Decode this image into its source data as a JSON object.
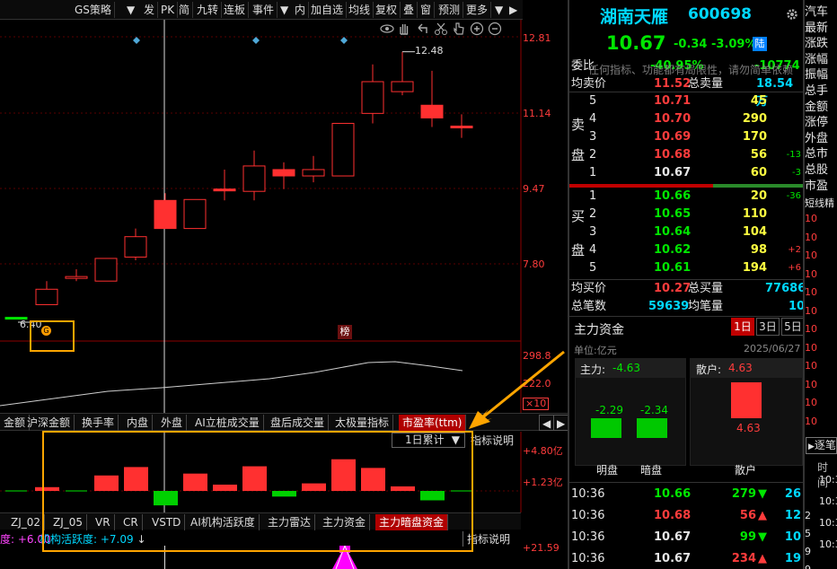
{
  "toolbar": {
    "items": [
      "GS策略",
      "▼",
      "发",
      "PK",
      "简",
      "九转",
      "连板",
      "事件",
      "▼",
      "内",
      "加自选",
      "均线",
      "复权",
      "叠",
      "窗",
      "预测",
      "更多",
      "▼",
      "▶"
    ]
  },
  "chart_icons": [
    "eye-icon",
    "hand-icon",
    "undo-icon",
    "scissors-icon",
    "zoom-in-icon",
    "zoom-out-icon"
  ],
  "price_axis": [
    "12.81",
    "11.14",
    "9.47",
    "7.80"
  ],
  "candles": {
    "high_label": "12.48",
    "low_label": "6.40",
    "bang_label": "榜",
    "g_label": "G",
    "items": [
      {
        "o": 6.62,
        "c": 6.62,
        "h": 6.62,
        "l": 6.62,
        "color": "green"
      },
      {
        "o": 6.9,
        "c": 7.24,
        "h": 7.42,
        "l": 6.9,
        "color": "red"
      },
      {
        "o": 7.52,
        "c": 7.48,
        "h": 7.68,
        "l": 7.42,
        "color": "red"
      },
      {
        "o": 7.42,
        "c": 7.92,
        "h": 7.92,
        "l": 7.42,
        "color": "red"
      },
      {
        "o": 7.95,
        "c": 8.4,
        "h": 8.58,
        "l": 7.88,
        "color": "red"
      },
      {
        "o": 8.58,
        "c": 9.2,
        "h": 9.36,
        "l": 8.58,
        "color": "red-filled"
      },
      {
        "o": 8.58,
        "c": 9.22,
        "h": 9.22,
        "l": 8.58,
        "color": "red"
      },
      {
        "o": 9.45,
        "c": 9.45,
        "h": 9.88,
        "l": 9.2,
        "color": "red"
      },
      {
        "o": 9.4,
        "c": 9.96,
        "h": 10.3,
        "l": 9.2,
        "color": "red"
      },
      {
        "o": 9.88,
        "c": 9.74,
        "h": 10.04,
        "l": 9.45,
        "color": "red-filled"
      },
      {
        "o": 9.88,
        "c": 9.74,
        "h": 10.18,
        "l": 9.6,
        "color": "red"
      },
      {
        "o": 9.74,
        "c": 10.9,
        "h": 10.9,
        "l": 9.74,
        "color": "red"
      },
      {
        "o": 11.12,
        "c": 11.82,
        "h": 12.2,
        "l": 10.9,
        "color": "red"
      },
      {
        "o": 11.6,
        "c": 11.82,
        "h": 12.48,
        "l": 11.52,
        "color": "red"
      },
      {
        "o": 11.3,
        "c": 11.02,
        "h": 12.06,
        "l": 10.82,
        "color": "red-filled"
      },
      {
        "o": 10.84,
        "c": 10.84,
        "h": 11.1,
        "l": 10.58,
        "color": "red"
      }
    ]
  },
  "vol_axis": {
    "top": "298.8",
    "mid": "222.0",
    "mult": "×10"
  },
  "tabs": [
    "金额",
    "沪深金额",
    "换手率",
    "内盘",
    "外盘",
    "AI立桩成交量",
    "盘后成交量",
    "太极量指标",
    "市盈率(ttm)"
  ],
  "indicator": {
    "select_label": "1日累计",
    "explain_label": "指标说明",
    "axis_top": "+4.80亿",
    "axis_mid": "+1.23亿",
    "bars": [
      0.0,
      0.3,
      0.0,
      1.23,
      1.9,
      -1.15,
      1.38,
      0.5,
      1.96,
      -0.45,
      0.6,
      2.52,
      1.83,
      0.36,
      -0.75,
      0.0
    ]
  },
  "bottom_tabs": [
    "ZJ_02",
    "ZJ_05",
    "VR",
    "CR",
    "VSTD",
    "AI机构活跃度",
    "主力雷达",
    "主力资金",
    "主力暗盘资金"
  ],
  "bottom_status": {
    "left": "度: +6.00",
    "mid_label": "机构活跃度: +7.09",
    "explain": "指标说明",
    "axis": "+21.59"
  },
  "overlay_text": "任何指标、功能都有局限性，请勿简单依赖",
  "quote": {
    "name": "湖南天雁",
    "code": "600698",
    "price": "10.67",
    "change": "-0.34",
    "pct": "-3.09%",
    "badge": "陆",
    "wei_bi_label": "委比",
    "wei_bi": "-40.95%",
    "wei_cha": "-10774",
    "jun_mai_label": "均卖价",
    "jun_mai": "11.52",
    "zong_mai_label": "总卖量",
    "zong_mai": "18.54万",
    "sell_label_1": "卖",
    "sell_label_2": "盘",
    "buy_label_1": "买",
    "buy_label_2": "盘",
    "asks": [
      {
        "lvl": "5",
        "price": "10.71",
        "vol": "45",
        "chg": ""
      },
      {
        "lvl": "4",
        "price": "10.70",
        "vol": "290",
        "chg": ""
      },
      {
        "lvl": "3",
        "price": "10.69",
        "vol": "170",
        "chg": ""
      },
      {
        "lvl": "2",
        "price": "10.68",
        "vol": "56",
        "chg": "-13"
      },
      {
        "lvl": "1",
        "price": "10.67",
        "vol": "60",
        "chg": "-3"
      }
    ],
    "bids": [
      {
        "lvl": "1",
        "price": "10.66",
        "vol": "20",
        "chg": "-36"
      },
      {
        "lvl": "2",
        "price": "10.65",
        "vol": "110",
        "chg": ""
      },
      {
        "lvl": "3",
        "price": "10.64",
        "vol": "104",
        "chg": ""
      },
      {
        "lvl": "4",
        "price": "10.62",
        "vol": "98",
        "chg": "+2"
      },
      {
        "lvl": "5",
        "price": "10.61",
        "vol": "194",
        "chg": "+6"
      }
    ],
    "jun_buy_label": "均买价",
    "jun_buy": "10.27",
    "zong_buy_label": "总买量",
    "zong_buy": "77686",
    "zong_bi_label": "总笔数",
    "zong_bi": "59639",
    "jun_bi_label": "均笔量",
    "jun_bi": "10"
  },
  "fund": {
    "title": "主力资金",
    "tabs": [
      "1日",
      "3日",
      "5日"
    ],
    "unit": "单位:亿元",
    "date": "2025/06/27",
    "main_label": "主力:",
    "main_value": "-4.63",
    "retail_label": "散户:",
    "retail_value": "4.63",
    "ming": "-2.29",
    "an": "-2.34",
    "retail_bar": "4.63",
    "x_labels": [
      "明盘",
      "暗盘",
      "散户"
    ]
  },
  "ticks": [
    {
      "time": "10:36",
      "price": "10.66",
      "vol": "279",
      "dir": "down",
      "n": "26"
    },
    {
      "time": "10:36",
      "price": "10.68",
      "vol": "56",
      "dir": "up",
      "n": "12"
    },
    {
      "time": "10:36",
      "price": "10.67",
      "vol": "99",
      "dir": "down",
      "n": "10"
    },
    {
      "time": "10:36",
      "price": "10.67",
      "vol": "234",
      "dir": "up",
      "n": "19"
    }
  ],
  "edge": {
    "top": [
      "汽车",
      "最新",
      "涨跌",
      "涨幅",
      "振幅",
      "总手",
      "金额",
      "涨停",
      "外盘",
      "总市",
      "总股",
      "市盈",
      "短线精"
    ],
    "right_vals": [
      "10",
      "10",
      "10",
      "10",
      "10",
      "10",
      "10",
      "10",
      "10",
      "10",
      "10",
      "10"
    ],
    "btn": "逐笔",
    "time_label": "时间",
    "times": [
      "10:3",
      "10:3",
      "10:3",
      "10:3"
    ],
    "nums": [
      "2",
      "5",
      "9",
      "9"
    ]
  }
}
